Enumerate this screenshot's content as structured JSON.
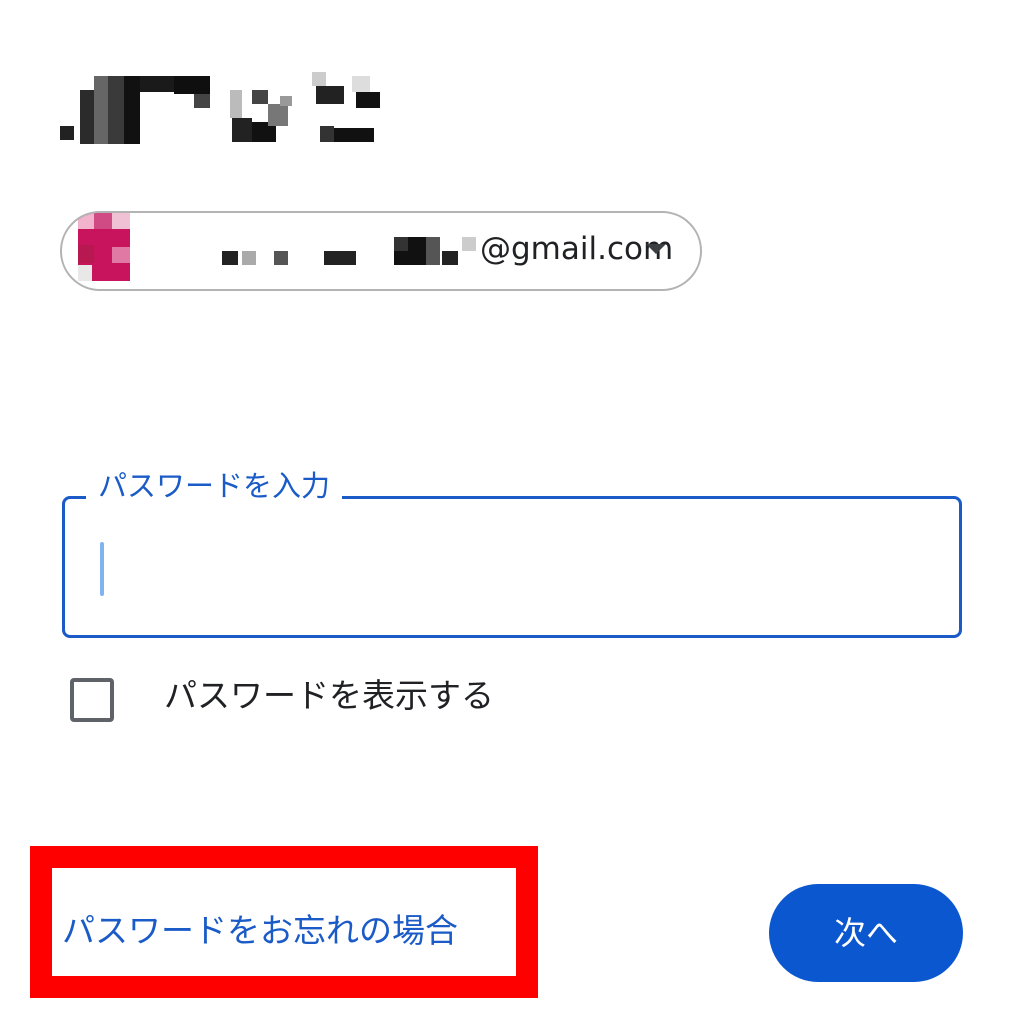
{
  "account": {
    "email_visible_suffix": "@gmail.com",
    "caret_icon": "arrow-drop-down-icon"
  },
  "password": {
    "label": "パスワードを入力",
    "value": ""
  },
  "show_password": {
    "label": "パスワードを表示する",
    "checked": false
  },
  "forgot_password": {
    "label": "パスワードをお忘れの場合"
  },
  "next_button": {
    "label": "次へ"
  },
  "colors": {
    "primary": "#0b57d0",
    "label_blue": "#1a5bc7",
    "highlight_red": "#ff0000"
  }
}
